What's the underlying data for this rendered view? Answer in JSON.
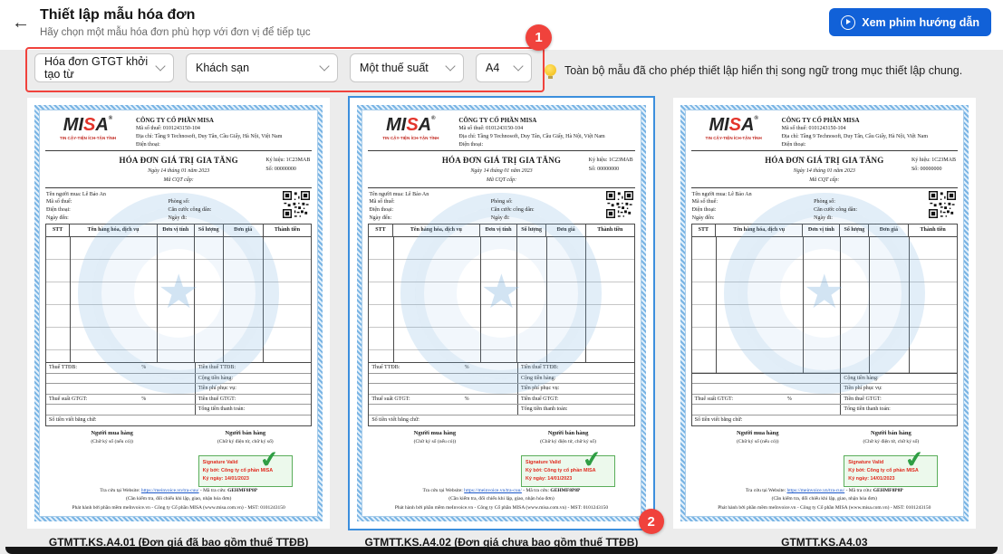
{
  "header": {
    "title": "Thiết lập mẫu hóa đơn",
    "subtitle": "Hãy chọn một mẫu hóa đơn phù hợp với đơn vị để tiếp tục",
    "help_button": "Xem phim hướng dẫn"
  },
  "badges": {
    "step1": "1",
    "step2": "2"
  },
  "filters": {
    "dropdowns": [
      {
        "value": "Hóa đơn GTGT khởi tạo từ"
      },
      {
        "value": "Khách sạn"
      },
      {
        "value": "Một thuế suất"
      },
      {
        "value": "A4"
      }
    ],
    "tip": "Toàn bộ mẫu đã cho phép thiết lập hiển thị song ngữ trong mục thiết lập chung."
  },
  "colors": {
    "primary_blue": "#1161d8",
    "highlight_red": "#f0423c",
    "selected_border": "#3c8fdd",
    "signature_green": "#5aae5a",
    "signature_text_red": "#e02a1e"
  },
  "invoice": {
    "logo": {
      "pre": "MI",
      "s": "S",
      "post": "A",
      "tagline": "TIN CẬY-TIỆN ÍCH-TẬN TÌNH"
    },
    "company": {
      "name": "CÔNG TY CỔ PHẦN MISA",
      "tax_line": "Mã số thuế: 0101243150-104",
      "address_line": "Địa chỉ: Tầng 9 Technosoft, Duy Tân, Cầu Giấy, Hà Nội, Việt Nam",
      "phone_line": "Điện thoại:"
    },
    "title": "HÓA ĐƠN GIÁ TRỊ GIA TĂNG",
    "date_line": "Ngày 14 tháng 01 năm 2023",
    "cqt_line": "Mã CQT cấp:",
    "serial_line": "Ký hiệu: 1C23MAB",
    "number_line": "Số: 00000000",
    "buyer": {
      "name_line": "Tên người mua: Lê Bảo An",
      "tax_line": "Mã số thuế:",
      "phone_line": "Điện thoại:",
      "checkin_line": "Ngày đến:",
      "room_line": "Phòng số:",
      "id_line": "Căn cước công dân:",
      "checkout_line": "Ngày đi:"
    },
    "table": {
      "headers": [
        "STT",
        "Tên hàng hóa, dịch vụ",
        "Đơn vị tính",
        "Số lượng",
        "Đơn giá",
        "Thành tiền"
      ]
    },
    "totals": {
      "ttdb_label": "Thuế TTĐB:",
      "percent": "%",
      "ttdb_amount_label": "Tiền thuế TTĐB:",
      "subtotal_label": "Cộng tiền hàng:",
      "service_label": "Tiền phí phục vụ:",
      "vat_rate_label": "Thuế suất GTGT:",
      "vat_amount_label": "Tiền thuế GTGT:",
      "total_label": "Tổng tiền thanh toán:",
      "words_label": "Số tiền viết bằng chữ:"
    },
    "signatures": {
      "buyer_title": "Người mua hàng",
      "buyer_note": "(Chữ ký số (nếu có))",
      "seller_title": "Người bán hàng",
      "seller_note": "(Chữ ký điện tử, chữ ký số)"
    },
    "signature_stamp": {
      "line1": "Signature Valid",
      "line2": "Ký bởi: Công ty cổ phần MISA",
      "line3": "Ký ngày: 14/01/2023"
    },
    "footer": {
      "lookup_prefix": "Tra cứu tại Website:",
      "lookup_url": "https://meinvoice.vn/tra-cuu/",
      "lookup_sep": "- Mã tra cứu:",
      "lookup_code": "GEHMF8P8P",
      "check_note": "(Cần kiểm tra, đối chiếu khi lập, giao, nhận hóa đơn)",
      "publisher": "Phát hành bởi phần mềm meInvoice.vn - Công ty Cổ phần MISA (www.misa.com.vn) - MST: 0101243150"
    }
  },
  "cards": [
    {
      "label": "GTMTT.KS.A4.01 (Đơn giá đã bao gồm thuế TTĐB)",
      "has_ttdb": true,
      "selected": false
    },
    {
      "label": "GTMTT.KS.A4.02 (Đơn giá chưa bao gồm thuế TTĐB)",
      "has_ttdb": true,
      "selected": true
    },
    {
      "label": "GTMTT.KS.A4.03",
      "has_ttdb": false,
      "selected": false
    }
  ]
}
